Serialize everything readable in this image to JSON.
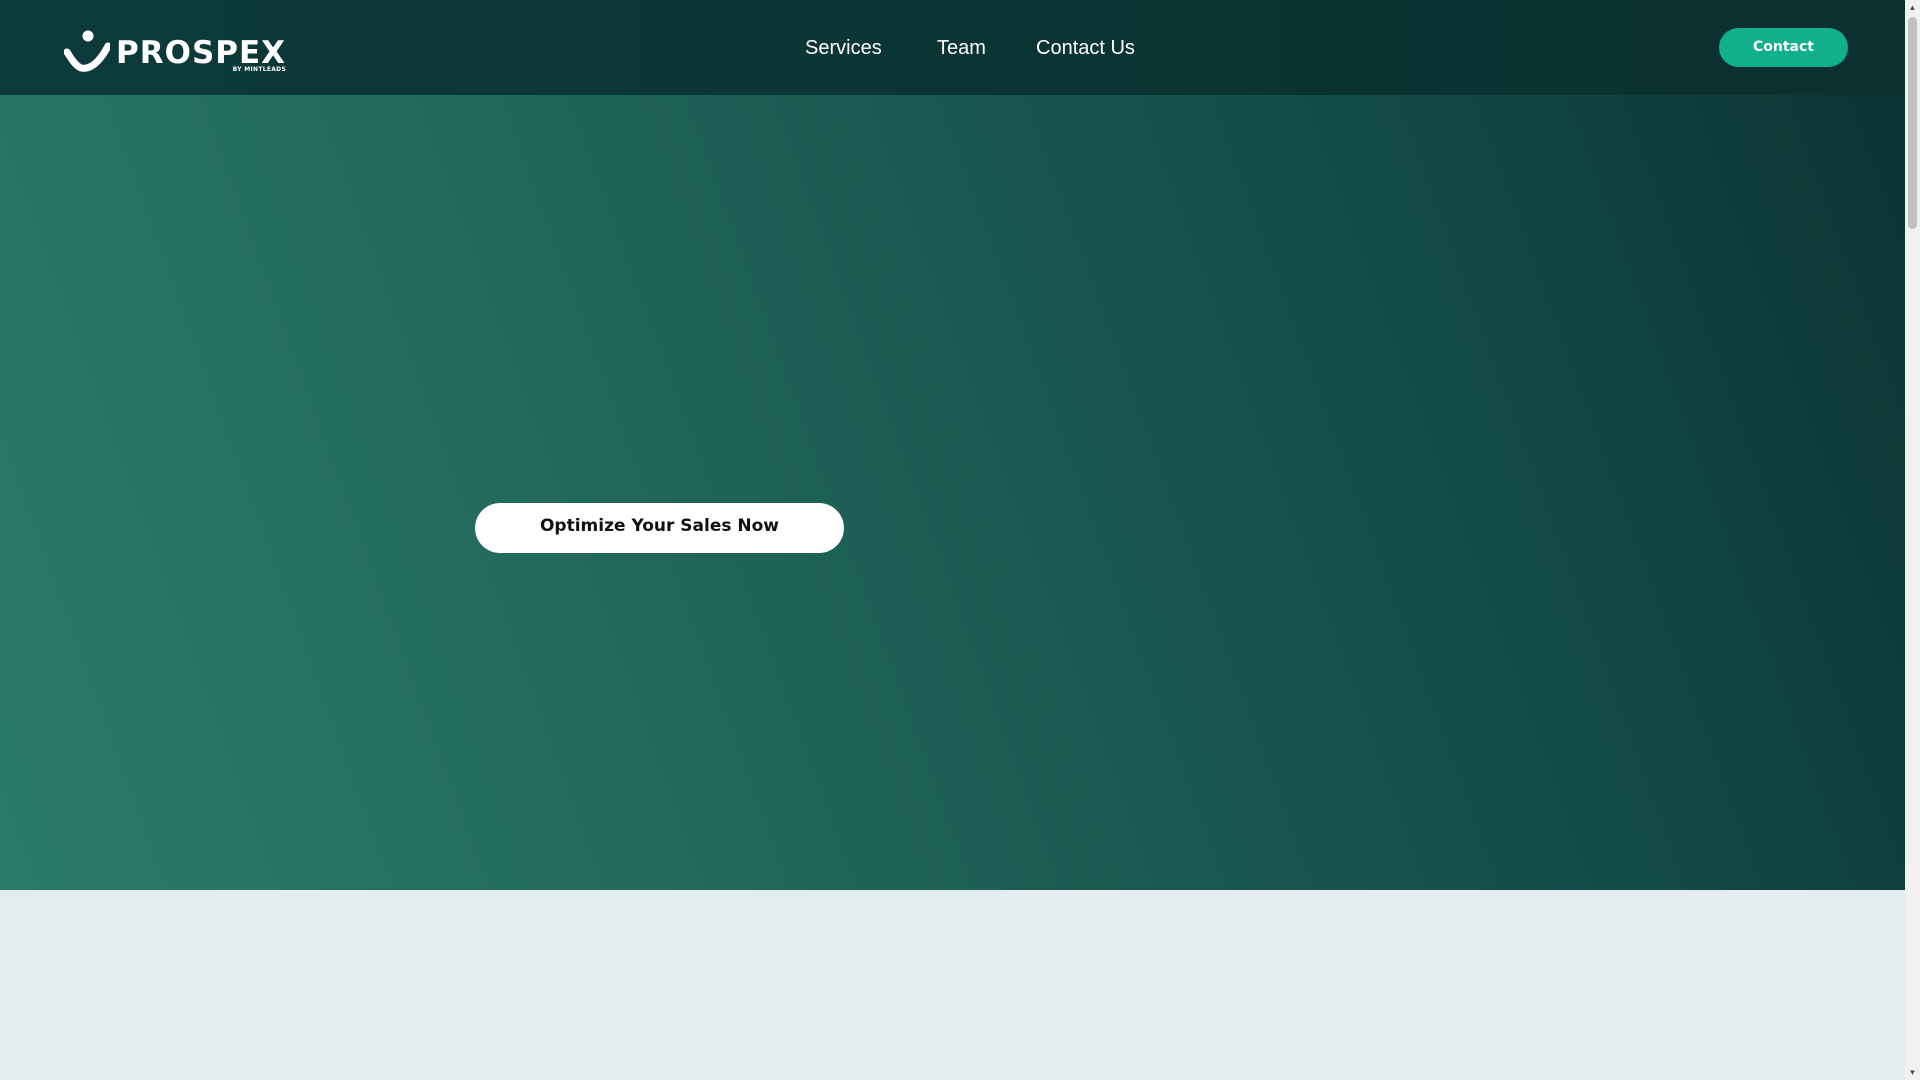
{
  "header": {
    "logo": {
      "wordmark": "PROSPEX",
      "tagline": "BY MINTLEADS"
    },
    "nav": [
      {
        "label": "Services"
      },
      {
        "label": "Team"
      },
      {
        "label": "Contact Us"
      }
    ],
    "cta_label": "Contact"
  },
  "hero": {
    "cta_label": "Optimize Your Sales Now"
  },
  "colors": {
    "header_bg": "#0c3a3a",
    "accent": "#0fb08b",
    "hero_light": "#2b7b6a",
    "hero_dark": "#0c3434",
    "section_bg": "#e3ecee"
  },
  "icons": {
    "logo_mark": "checkmark-person-icon",
    "scroll_up": "triangle-up-icon",
    "scroll_down": "triangle-down-icon"
  }
}
